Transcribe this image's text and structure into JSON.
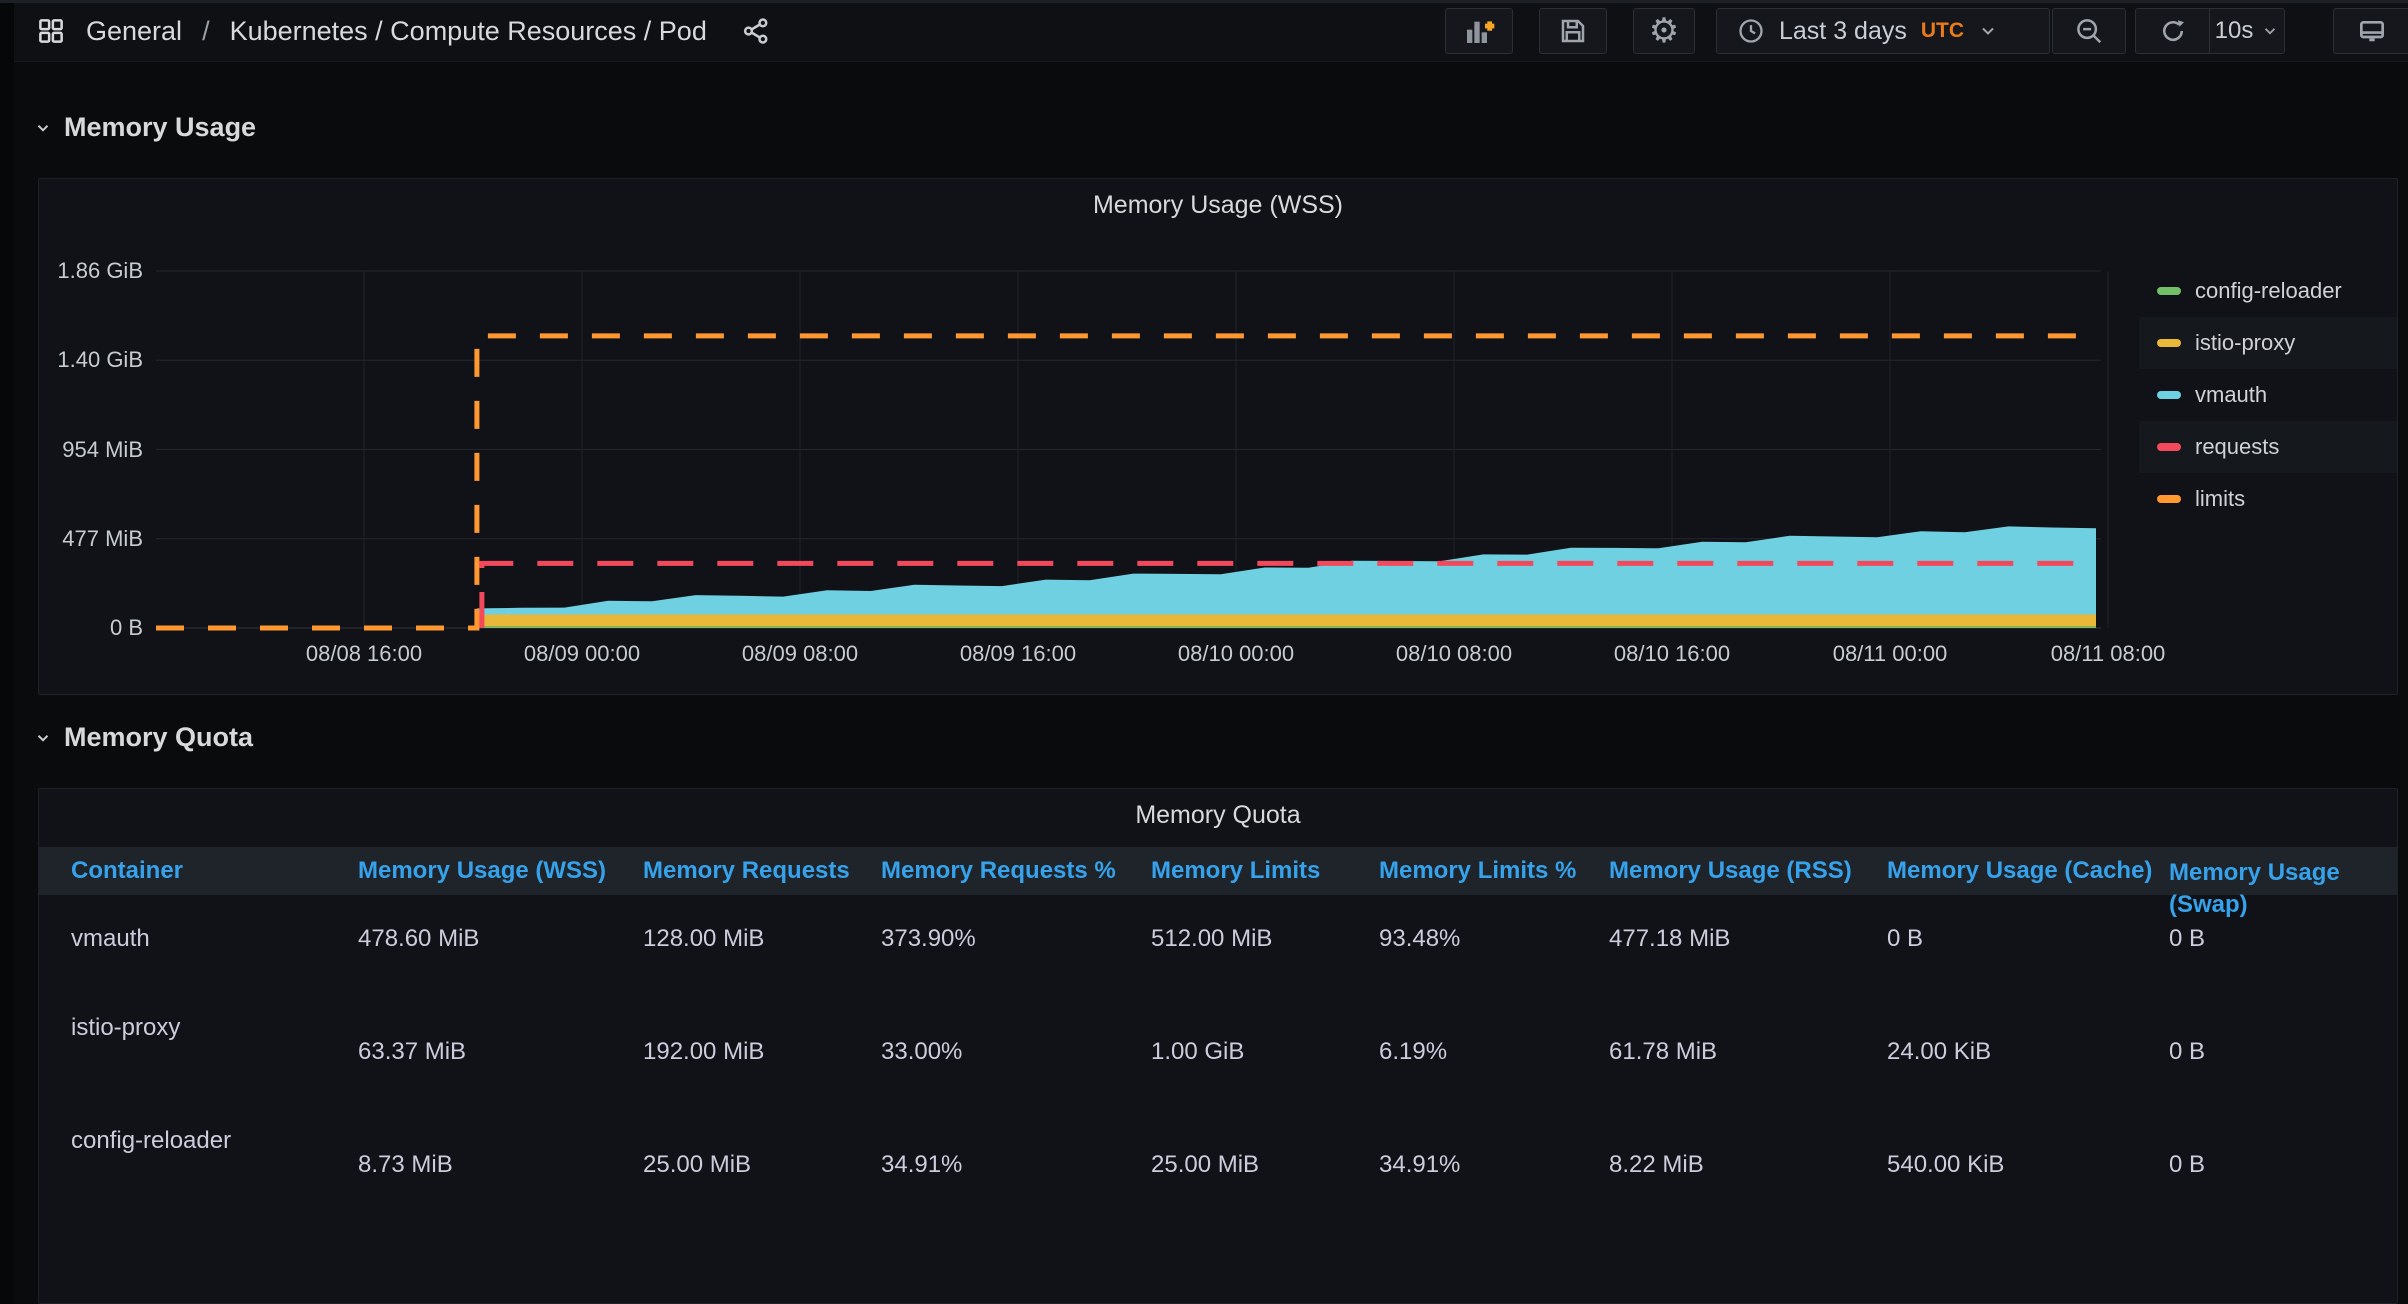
{
  "header": {
    "breadcrumb": {
      "section": "General",
      "separator": "/",
      "title": "Kubernetes / Compute Resources / Pod"
    },
    "icons": {
      "apps": "apps-grid-icon",
      "share": "share-icon"
    },
    "toolbar": {
      "add_panel_icon": "add-panel-icon",
      "save_icon": "save-dashboard-icon",
      "settings_icon": "gear-icon",
      "time_range": {
        "icon": "clock-icon",
        "label": "Last 3 days",
        "timezone": "UTC",
        "timezone_color": "#EB7B18",
        "chevron": "chevron-down-icon"
      },
      "zoom_out_icon": "zoom-out-icon",
      "refresh": {
        "icon": "refresh-icon",
        "interval": "10s",
        "chevron": "chevron-down-icon"
      },
      "kiosk_icon": "monitor-icon"
    }
  },
  "sections": {
    "memory_usage": "Memory Usage",
    "memory_quota": "Memory Quota"
  },
  "chart_data": {
    "type": "area",
    "title": "Memory Usage (WSS)",
    "y_ticks": [
      "1.86 GiB",
      "1.40 GiB",
      "954 MiB",
      "477 MiB",
      "0 B"
    ],
    "y_max_mib": 1908,
    "x_ticks": [
      "08/08 16:00",
      "08/09 00:00",
      "08/09 08:00",
      "08/09 16:00",
      "08/10 00:00",
      "08/10 08:00",
      "08/10 16:00",
      "08/11 00:00",
      "08/11 08:00"
    ],
    "series_start_frac": 0.165,
    "grid": true,
    "legend_position": "right",
    "legend": [
      {
        "label": "config-reloader",
        "color": "#73BF69",
        "row_highlight": false
      },
      {
        "label": "istio-proxy",
        "color": "#EAB839",
        "row_highlight": true
      },
      {
        "label": "vmauth",
        "color": "#6ED0E0",
        "row_highlight": false
      },
      {
        "label": "requests",
        "color": "#F2495C",
        "row_highlight": true
      },
      {
        "label": "limits",
        "color": "#FF9830",
        "row_highlight": false
      }
    ],
    "series": [
      {
        "name": "config-reloader",
        "render": "stacked-area",
        "color": "#73BF69",
        "value_mib": 8.7
      },
      {
        "name": "istio-proxy",
        "render": "stacked-area",
        "color": "#EAB839",
        "value_mib": 63.4
      },
      {
        "name": "vmauth",
        "render": "stacked-area",
        "color": "#6ED0E0",
        "stack_top_mib": [
          90,
          108,
          124,
          138,
          150,
          161,
          172,
          183,
          194,
          205,
          216,
          227,
          239,
          251,
          263,
          276,
          289,
          302,
          316,
          330,
          344,
          358,
          372,
          386,
          400,
          414,
          428,
          441,
          454,
          466,
          478,
          489,
          500,
          510,
          519,
          528,
          537,
          548
        ]
      },
      {
        "name": "requests",
        "render": "dashed-line",
        "color": "#F2495C",
        "value_mib": 345
      },
      {
        "name": "limits",
        "render": "dashed-line",
        "color": "#FF9830",
        "value_mib": 1561,
        "zero_before_start": true
      }
    ]
  },
  "table": {
    "title": "Memory Quota",
    "header_color": "#35A2EB",
    "columns": [
      "Container",
      "Memory Usage (WSS)",
      "Memory Requests",
      "Memory Requests %",
      "Memory Limits",
      "Memory Limits %",
      "Memory Usage (RSS)",
      "Memory Usage (Cache)",
      "Memory Usage (Swap)"
    ],
    "rows": [
      [
        "vmauth",
        "478.60 MiB",
        "128.00 MiB",
        "373.90%",
        "512.00 MiB",
        "93.48%",
        "477.18 MiB",
        "0 B",
        "0 B"
      ],
      [
        "istio-proxy",
        "63.37 MiB",
        "192.00 MiB",
        "33.00%",
        "1.00 GiB",
        "6.19%",
        "61.78 MiB",
        "24.00 KiB",
        "0 B"
      ],
      [
        "config-reloader",
        "8.73 MiB",
        "25.00 MiB",
        "34.91%",
        "25.00 MiB",
        "34.91%",
        "8.22 MiB",
        "540.00 KiB",
        "0 B"
      ]
    ]
  },
  "colors": {
    "page_bg": "#0a0b0d",
    "panel_bg": "#101217",
    "grid_line": "#24272d",
    "axis_text": "#c7ccd1",
    "table_header_blue": "#35a2eb",
    "accent_orange": "#EB7B18"
  }
}
